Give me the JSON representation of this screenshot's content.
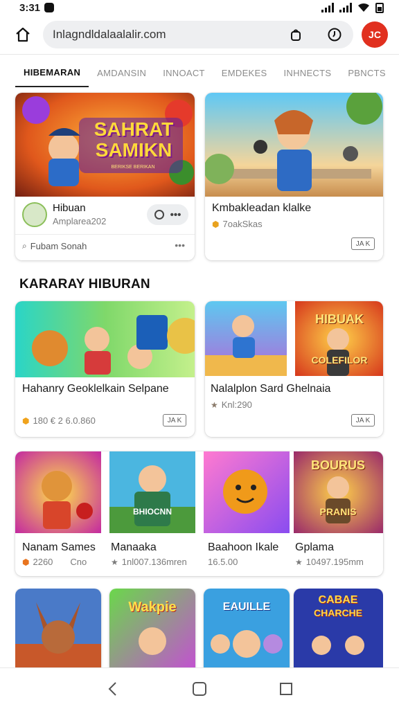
{
  "status_bar": {
    "time": "3:31"
  },
  "browser": {
    "url": "Inlagndldalaalalir.com",
    "profile_initials": "JC"
  },
  "tabs": [
    {
      "label": "HIBEMARAN",
      "active": true
    },
    {
      "label": "AMDANSIN",
      "active": false
    },
    {
      "label": "INNOACT",
      "active": false
    },
    {
      "label": "EMDEKES",
      "active": false
    },
    {
      "label": "INHNECTS",
      "active": false
    },
    {
      "label": "PBNCTS",
      "active": false
    }
  ],
  "featured": [
    {
      "banner_line1": "SAHRAT",
      "banner_line2": "SAMIKN",
      "banner_sub": "BERIKSE BERIKAN",
      "channel_name": "Hibuan",
      "channel_handle": "Amplarea202",
      "footer_text": "Fubam Sonah"
    },
    {
      "title": "Kmbakleadan klalke",
      "meta": "7oakSkas"
    }
  ],
  "section_title": "KARARAY HIBURAN",
  "row1": [
    {
      "title": "Hahanry Geoklelkain Selpane",
      "meta": "180 € 2 6.0.860"
    },
    {
      "title": "Nalalplon Sard Ghelnaia",
      "meta": "Knl:290"
    }
  ],
  "row1_small_banner": {
    "line1": "HIBUAK",
    "line2": "COLEFILOR"
  },
  "row2": [
    {
      "title": "Nanam Sames",
      "meta": "2260",
      "extra": "Cno"
    },
    {
      "title": "Manaaka",
      "meta": "1nl007.136mren"
    },
    {
      "title": "Baahoon Ikale",
      "meta": "16.5.00"
    },
    {
      "title": "Gplama",
      "meta": "10497.195mm"
    }
  ],
  "row2_banners": {
    "b2": "BHIOCNN",
    "b4_top": "BOURUS",
    "b4_bottom": "PRANIS"
  },
  "row3_banners": {
    "b1": "",
    "b2": "Wakpie",
    "b3": "EAUILLE",
    "b4_top": "CABAE",
    "b4_bottom": "CHARCHE"
  },
  "badge_label": "JA K"
}
